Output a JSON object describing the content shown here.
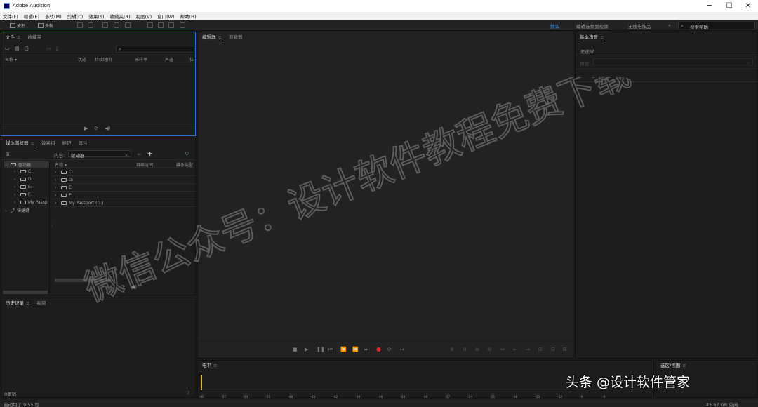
{
  "window": {
    "title": "Adobe Audition"
  },
  "menu": [
    "文件(F)",
    "编辑(E)",
    "多轨(M)",
    "剪辑(C)",
    "效果(S)",
    "收藏夹(R)",
    "视图(V)",
    "窗口(W)",
    "帮助(H)"
  ],
  "toolbar": {
    "waveform_label": "波形",
    "multitrack_label": "多轨",
    "workspaces": [
      "默认",
      "编辑音频到视频",
      "无线电作品"
    ],
    "search_placeholder": "搜索帮助"
  },
  "files_panel": {
    "tabs": [
      "文件",
      "收藏夹"
    ],
    "columns": [
      "名称 ▾",
      "状态",
      "持续时间",
      "采样率",
      "声道",
      "位"
    ]
  },
  "media_panel": {
    "tabs": [
      "媒体浏览器",
      "效果组",
      "标记",
      "属性"
    ],
    "content_label": "内容:",
    "content_value": "驱动器",
    "left_tree": [
      {
        "label": "驱动器",
        "type": "root"
      },
      {
        "label": "C:"
      },
      {
        "label": "D:"
      },
      {
        "label": "E:"
      },
      {
        "label": "F:"
      },
      {
        "label": "My Passp"
      },
      {
        "label": "快捷键",
        "type": "root"
      }
    ],
    "columns": [
      "名称 ▾",
      "持续时间",
      "媒体类型"
    ],
    "right_list": [
      "C:",
      "D:",
      "E:",
      "F:",
      "My Passport (G:)"
    ]
  },
  "history_panel": {
    "tabs": [
      "历史记录",
      "视频"
    ],
    "footer": "0撤销"
  },
  "editor_panel": {
    "tabs": [
      "编辑器",
      "混音器"
    ]
  },
  "essential_sound": {
    "title": "基本声音",
    "subtitle": "无选择",
    "preset_label": "预设:"
  },
  "levels_panel": {
    "title": "电平",
    "ticks": [
      "dB",
      "-57",
      "-54",
      "-51",
      "-48",
      "-45",
      "-42",
      "-39",
      "-36",
      "-33",
      "-30",
      "-27",
      "-24",
      "-21",
      "-18",
      "-15",
      "-12",
      "-9",
      "-6"
    ]
  },
  "selection_panel": {
    "title": "选区/视图"
  },
  "status": {
    "left": "启动用了 9.55 秒",
    "right": "45.67 GB 空闲"
  },
  "overlay": {
    "watermark": "微信公众号：设计软件教程免费下载",
    "attribution": "头条 @设计软件管家"
  },
  "colors": {
    "accent": "#2d6ec8",
    "record": "#e0242b",
    "workspace_active": "#3a8ee6"
  }
}
